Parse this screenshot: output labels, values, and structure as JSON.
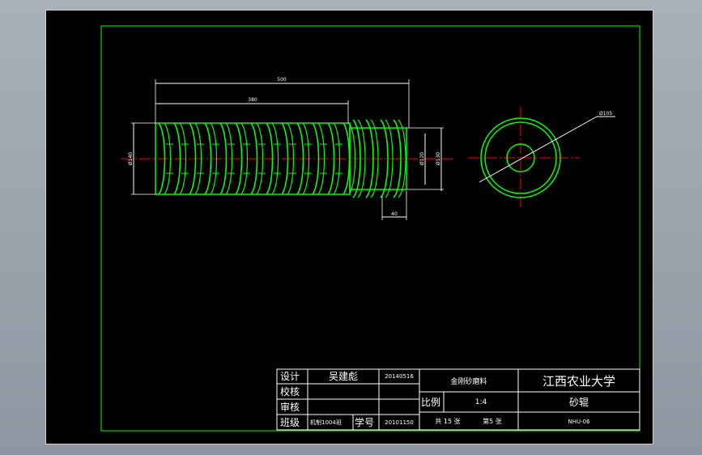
{
  "drawing": {
    "dims": {
      "overall_length": "500",
      "threaded_length": "380",
      "outer_diameter": "Ø140",
      "inner_diameter": "Ø120",
      "mid_diameter": "Ø130",
      "step_length": "40",
      "end_diameter": "Ø105"
    }
  },
  "title_block": {
    "design_label": "设计",
    "designer": "吴建彪",
    "design_date": "20140516",
    "check_label": "校核",
    "review_label": "审核",
    "class_label": "班级",
    "class_value": "机制1004班",
    "student_no_label": "学号",
    "student_no": "20101150",
    "project": "金刚砂磨料",
    "university": "江西农业大学",
    "scale_label": "比例",
    "scale_value": "1:4",
    "part_name": "砂辊",
    "total_sheets": "共 15 张",
    "sheet_no": "第5 张",
    "drawing_no": "NHU-06"
  },
  "colors": {
    "background": "#000000",
    "border": "#00ff00",
    "part": "#00ff00",
    "centerline": "#ff0000",
    "dimension": "#ffffff",
    "text": "#ffffff"
  }
}
